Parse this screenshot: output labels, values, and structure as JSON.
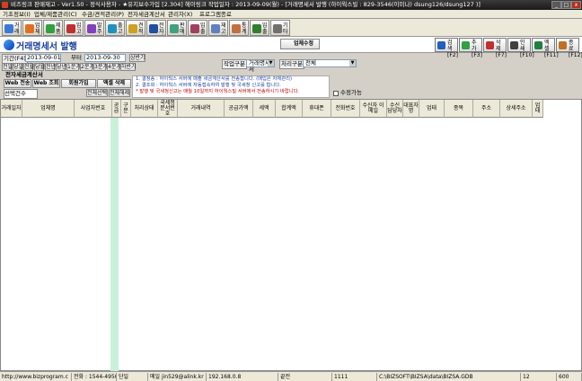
{
  "window": {
    "title": "비즈링크 판매재고 - Ver1.50 - 정식사용자 - ★유지보수가입 [2.304] 헤이링크          작업일자 : 2013-09-09(월) - [거래명세서 발행 (하이웍스빌 : 829-3546(이미나)  dsung126/dsung127 )]",
    "min": "_",
    "max": "□",
    "close": "x"
  },
  "menu": [
    "기초정보(I)",
    "업체/제품관리(C)",
    "수금/견적관리(P)",
    "전자세금계산서",
    "관리자(X)",
    "프로그램종료"
  ],
  "toolbar": [
    "거래처 관리",
    "업체 관리",
    "제품 관리",
    "입고 관리",
    "발주 관리",
    "출고 관리",
    "견적 관리",
    "전자 세금",
    "판매 관리",
    "입출금 관리",
    "재고 현황",
    "통계 관리",
    "입출금 통계",
    "기타"
  ],
  "colors": {
    "title": "#1a3ea0",
    "accent_col": "#c8f0d8",
    "notice1": "#1a3ea0",
    "notice2": "#c00000"
  },
  "page": {
    "title": "거래명세서 발행",
    "edit_button": "업체수정"
  },
  "quick": [
    "검색 [F2]",
    "추가 [F3]",
    "삭제 [F7]",
    "인쇄 [F10]",
    "엑셀 [F11]",
    "종료 [F12]"
  ],
  "filter": {
    "period_label": "기간(F4)",
    "start": "2013-09-01",
    "to": "부터",
    "end": "2013-09-30",
    "half_label": "상반기",
    "quick": [
      "전일",
      "당일",
      "전월",
      "당월",
      "전년",
      "당년",
      "1분기",
      "2분기",
      "3분기",
      "4분기",
      "하반기"
    ],
    "type_label": "작업구분",
    "type_value": "거래명세서",
    "proc_label": "처리구분",
    "proc_value": "전체"
  },
  "etax": {
    "header": "전자세금계산서",
    "buttons": [
      "Web 전송",
      "Web 조회",
      "회원가입",
      "엑셀 삭제"
    ],
    "count_label": "선택건수",
    "select_all": "전체선택",
    "deselect_all": "전체해제",
    "notice1": "1. 결정송 : 하이웍스 서버에 매출 세금계산서를 전송합니다. (매입은 자체관리)",
    "notice2": "2. 결조회 : 하이웍스 서버에 자동접속하여 발행 및 국세청 신고를 합니다.",
    "notice3": "* 발행 및 국세청신고는 매월 10일까지 하이웍스빌 서버에서 전송하시기 바랍니다.",
    "modify_check": "수정가능"
  },
  "grid": {
    "columns": [
      "거래일자",
      "업체명",
      "사업자번호",
      "공급",
      "구분",
      "처리상태",
      "국세청 문서번호",
      "거래내역",
      "공급가액",
      "세액",
      "합계액",
      "휴대폰",
      "전화번호",
      "수신자 이메일",
      "수신 담당자",
      "대표자명",
      "업태",
      "종목",
      "주소",
      "상세주소",
      "업태"
    ]
  },
  "status": [
    "http://www.bizprogram.c",
    "전화 : 1544-4950",
    "단일",
    "메일 jin529@alink.kr",
    "192.168.0.8",
    "끝전",
    "1111",
    "C:\\BIZSOFT\\BIZSA\\data\\BIZSA.GDB",
    "12",
    "600"
  ]
}
